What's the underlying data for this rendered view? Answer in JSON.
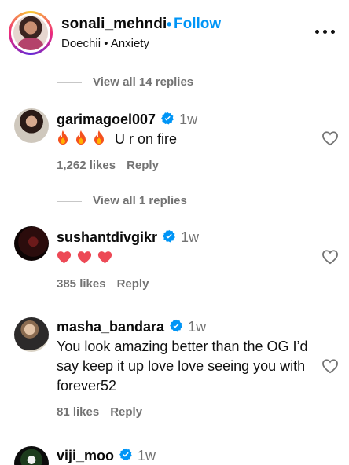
{
  "header": {
    "username": "sonali_mehndi",
    "separator": "•",
    "follow_label": "Follow",
    "audio": "Doechii • Anxiety"
  },
  "replies_1": "View all 14 replies",
  "replies_2": "View all 1 replies",
  "comments": [
    {
      "username": "garimagoel007",
      "verified": true,
      "time": "1w",
      "text": "U r on fire",
      "emoji": "fire-x3",
      "likes": "1,262 likes",
      "reply": "Reply"
    },
    {
      "username": "sushantdivgikr",
      "verified": true,
      "time": "1w",
      "text": "",
      "emoji": "heart-x3",
      "likes": "385 likes",
      "reply": "Reply"
    },
    {
      "username": "masha_bandara",
      "verified": true,
      "time": "1w",
      "text": "You look amazing better than the OG I’d say keep it up love love seeing you with forever52",
      "likes": "81 likes",
      "reply": "Reply"
    },
    {
      "username": "viji_moo",
      "verified": true,
      "time": "1w"
    }
  ],
  "colors": {
    "accent": "#0095f6",
    "secondary": "#737373",
    "heart_emoji": "#ed4956",
    "fire_emoji": "#f4511e"
  },
  "icons": [
    "more-icon",
    "verified-badge-icon",
    "heart-outline-icon",
    "fire-emoji",
    "heart-emoji"
  ]
}
